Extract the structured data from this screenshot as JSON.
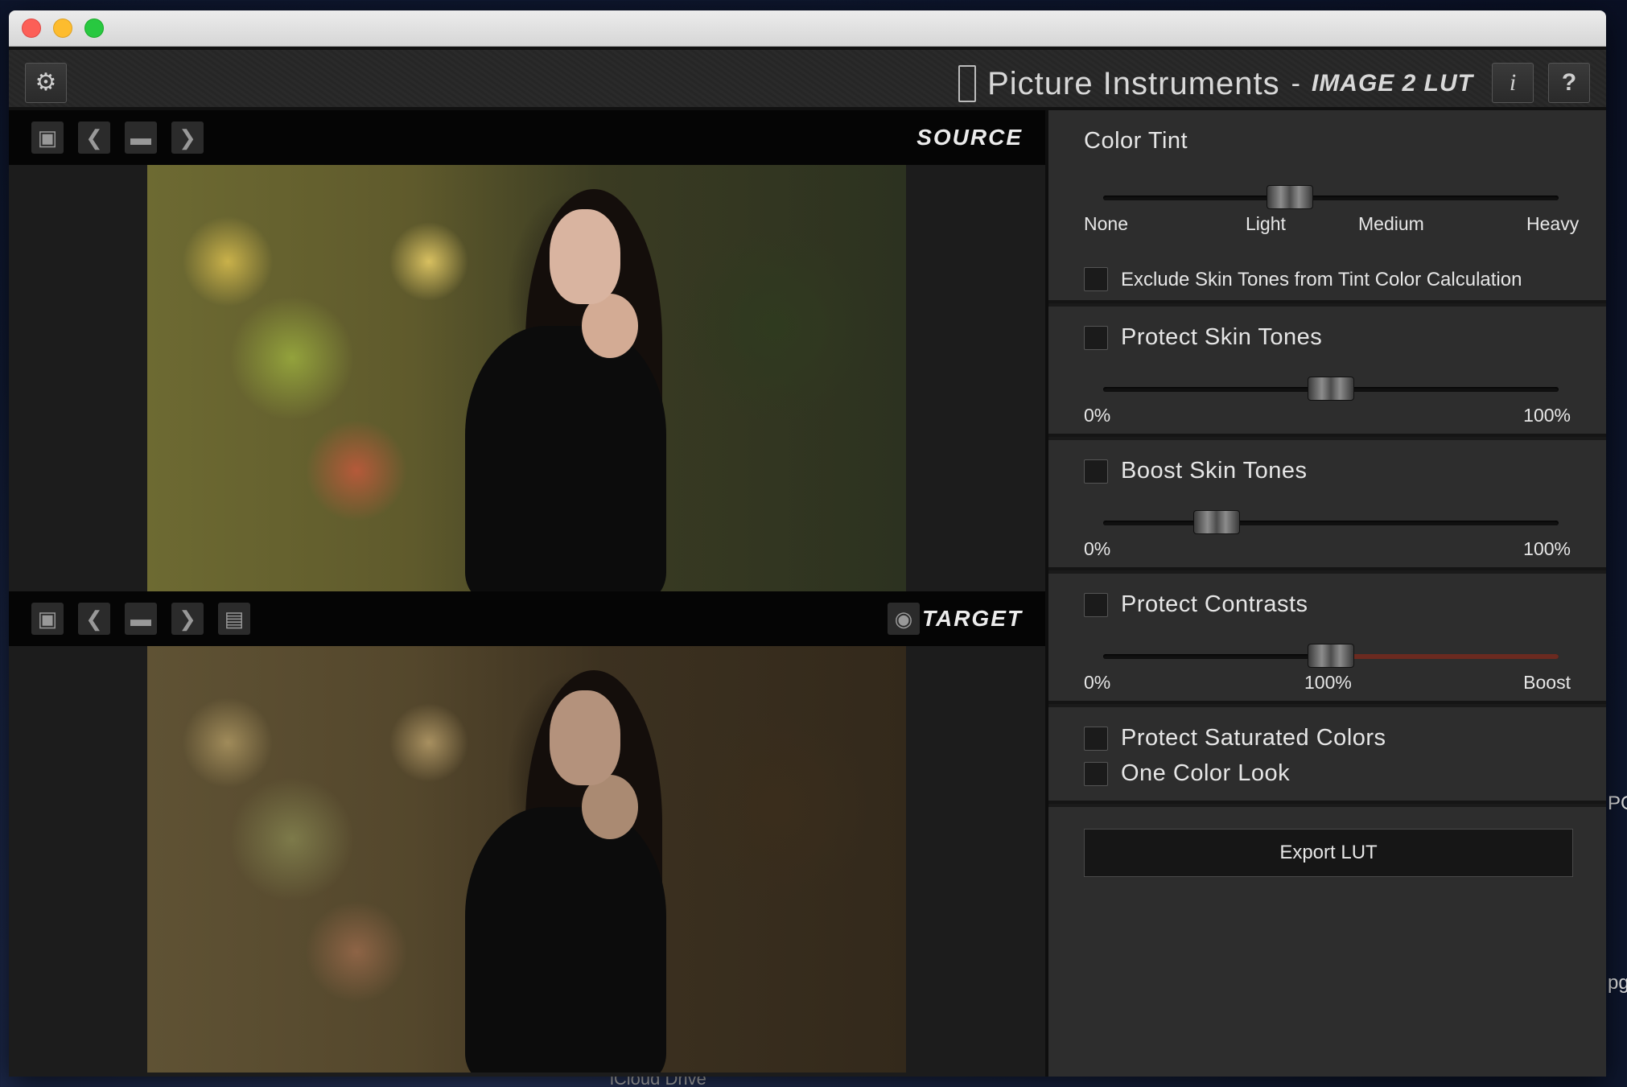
{
  "window": {
    "app_brand": "Picture Instruments",
    "separator": "-",
    "product": "IMAGE 2 LUT",
    "info_label": "i",
    "help_label": "?",
    "settings_icon": "gear-icon"
  },
  "source": {
    "label": "SOURCE",
    "tools": [
      "save-icon",
      "previous-icon",
      "folder-icon",
      "next-icon"
    ]
  },
  "target": {
    "label": "TARGET",
    "tools": [
      "save-icon",
      "previous-icon",
      "folder-icon",
      "next-icon",
      "save-as-icon"
    ],
    "preview_icon": "eye-icon"
  },
  "panel": {
    "color_tint": {
      "title": "Color Tint",
      "ticks": [
        "None",
        "Light",
        "Medium",
        "Heavy"
      ],
      "value": 0.4,
      "exclude_label": "Exclude Skin Tones from Tint Color Calculation",
      "exclude_checked": false
    },
    "protect_skin": {
      "label": "Protect Skin Tones",
      "checked": false,
      "min": "0%",
      "max": "100%",
      "value": 0.5
    },
    "boost_skin": {
      "label": "Boost Skin Tones",
      "checked": false,
      "min": "0%",
      "max": "100%",
      "value": 0.22
    },
    "protect_contrasts": {
      "label": "Protect Contrasts",
      "checked": false,
      "min": "0%",
      "mid": "100%",
      "max": "Boost",
      "value": 0.5
    },
    "protect_saturated": {
      "label": "Protect Saturated Colors",
      "checked": false
    },
    "one_color": {
      "label": "One Color Look",
      "checked": false
    },
    "export_label": "Export LUT"
  },
  "desktop": {
    "finder_item": "iCloud Drive",
    "side_text_1": "PG",
    "side_text_2": "pg"
  },
  "colors": {
    "contrast_fill": "#6b2a20",
    "panel_bg": "#2d2d2d"
  }
}
